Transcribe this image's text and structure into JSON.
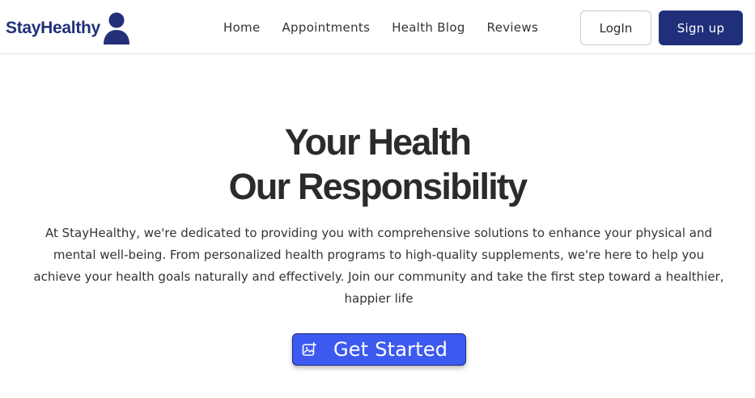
{
  "brand": {
    "name": "StayHealthy",
    "icon": "user-avatar-icon",
    "color": "#22307a"
  },
  "nav": {
    "links": [
      "Home",
      "Appointments",
      "Health Blog",
      "Reviews"
    ],
    "login_label": "LogIn",
    "signup_label": "Sign up"
  },
  "hero": {
    "title_line1": "Your Health",
    "title_line2": "Our Responsibility",
    "description": "At StayHealthy, we're dedicated to providing you with comprehensive solutions to enhance your physical and mental well-being. From personalized health programs to high-quality supplements, we're here to help you achieve your health goals naturally and effectively. Join our community and take the first step toward a healthier, happier life",
    "cta_label": "Get Started",
    "cta_icon": "image-add-icon"
  },
  "colors": {
    "primary": "#1f2f7a",
    "cta": "#3d5af0",
    "text": "#2b2b2b"
  }
}
